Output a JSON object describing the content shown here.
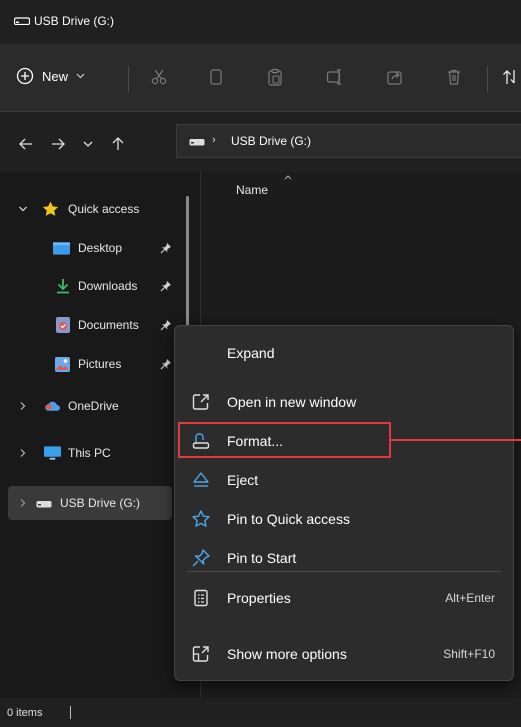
{
  "window": {
    "title": "USB Drive (G:)"
  },
  "toolbar": {
    "new_label": "New",
    "icons": [
      "cut-icon",
      "copy-icon",
      "paste-icon",
      "rename-icon",
      "share-icon",
      "delete-icon",
      "sort-icon"
    ]
  },
  "address": {
    "location": "USB Drive (G:)"
  },
  "file_list": {
    "column_name": "Name"
  },
  "sidebar": {
    "quick_access": "Quick access",
    "desktop": "Desktop",
    "downloads": "Downloads",
    "documents": "Documents",
    "pictures": "Pictures",
    "onedrive": "OneDrive",
    "this_pc": "This PC",
    "usb_drive": "USB Drive (G:)"
  },
  "context_menu": {
    "items": [
      {
        "label": "Expand",
        "shortcut": ""
      },
      {
        "label": "Open in new window",
        "shortcut": ""
      },
      {
        "label": "Format...",
        "shortcut": ""
      },
      {
        "label": "Eject",
        "shortcut": ""
      },
      {
        "label": "Pin to Quick access",
        "shortcut": ""
      },
      {
        "label": "Pin to Start",
        "shortcut": ""
      },
      {
        "label": "Properties",
        "shortcut": "Alt+Enter"
      },
      {
        "label": "Show more options",
        "shortcut": "Shift+F10"
      }
    ]
  },
  "status": {
    "items_count": "0 items"
  },
  "colors": {
    "accent": "#e0393e",
    "quick_access_star": "#f2c518",
    "folder_blue": "#3d9be9"
  }
}
